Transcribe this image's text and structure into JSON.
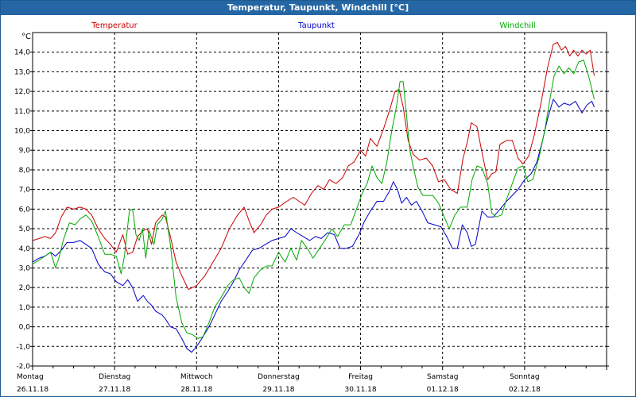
{
  "window": {
    "title": "Temperatur, Taupunkt, Windchill [°C]"
  },
  "chart_data": {
    "type": "line",
    "title": "Temperatur, Taupunkt, Windchill [°C]",
    "unit": "°C",
    "ylim": [
      -2.0,
      15.0
    ],
    "y_ticks": [
      "-2,0",
      "-1,0",
      "0,0",
      "1,0",
      "2,0",
      "3,0",
      "4,0",
      "5,0",
      "6,0",
      "7,0",
      "8,0",
      "9,0",
      "10,0",
      "11,0",
      "12,0",
      "13,0",
      "14,0"
    ],
    "x_range_days": 7,
    "x_day_labels": [
      {
        "day": "Montag",
        "date": "26.11.18"
      },
      {
        "day": "Dienstag",
        "date": "27.11.18"
      },
      {
        "day": "Mittwoch",
        "date": "28.11.18"
      },
      {
        "day": "Donnerstag",
        "date": "29.11.18"
      },
      {
        "day": "Freitag",
        "date": "30.11.18"
      },
      {
        "day": "Samstag",
        "date": "01.12.18"
      },
      {
        "day": "Sonntag",
        "date": "02.12.18"
      }
    ],
    "grid": true,
    "legend_position": "top",
    "series": [
      {
        "name": "Temperatur",
        "color": "#cc0000",
        "points": [
          [
            0.0,
            4.4
          ],
          [
            0.08,
            4.5
          ],
          [
            0.15,
            4.6
          ],
          [
            0.22,
            4.5
          ],
          [
            0.28,
            4.8
          ],
          [
            0.35,
            5.6
          ],
          [
            0.42,
            6.1
          ],
          [
            0.5,
            6.0
          ],
          [
            0.58,
            6.1
          ],
          [
            0.65,
            6.0
          ],
          [
            0.72,
            5.7
          ],
          [
            0.8,
            5.0
          ],
          [
            0.88,
            4.5
          ],
          [
            0.95,
            4.2
          ],
          [
            1.02,
            3.8
          ],
          [
            1.1,
            4.7
          ],
          [
            1.16,
            3.7
          ],
          [
            1.22,
            3.8
          ],
          [
            1.28,
            4.6
          ],
          [
            1.35,
            4.9
          ],
          [
            1.4,
            5.0
          ],
          [
            1.45,
            4.2
          ],
          [
            1.5,
            5.3
          ],
          [
            1.58,
            5.7
          ],
          [
            1.62,
            5.6
          ],
          [
            1.68,
            4.6
          ],
          [
            1.75,
            3.3
          ],
          [
            1.82,
            2.6
          ],
          [
            1.9,
            1.9
          ],
          [
            2.0,
            2.1
          ],
          [
            2.1,
            2.6
          ],
          [
            2.2,
            3.3
          ],
          [
            2.3,
            4.0
          ],
          [
            2.4,
            5.0
          ],
          [
            2.5,
            5.7
          ],
          [
            2.58,
            6.1
          ],
          [
            2.64,
            5.4
          ],
          [
            2.7,
            4.8
          ],
          [
            2.78,
            5.2
          ],
          [
            2.85,
            5.7
          ],
          [
            2.92,
            6.0
          ],
          [
            3.0,
            6.1
          ],
          [
            3.1,
            6.4
          ],
          [
            3.18,
            6.6
          ],
          [
            3.25,
            6.4
          ],
          [
            3.32,
            6.2
          ],
          [
            3.4,
            6.8
          ],
          [
            3.48,
            7.2
          ],
          [
            3.55,
            7.0
          ],
          [
            3.62,
            7.5
          ],
          [
            3.7,
            7.3
          ],
          [
            3.78,
            7.6
          ],
          [
            3.85,
            8.2
          ],
          [
            3.92,
            8.4
          ],
          [
            4.0,
            9.0
          ],
          [
            4.06,
            8.7
          ],
          [
            4.12,
            9.6
          ],
          [
            4.2,
            9.2
          ],
          [
            4.28,
            10.1
          ],
          [
            4.35,
            11.0
          ],
          [
            4.42,
            12.0
          ],
          [
            4.47,
            12.1
          ],
          [
            4.52,
            11.2
          ],
          [
            4.58,
            9.5
          ],
          [
            4.64,
            8.8
          ],
          [
            4.72,
            8.5
          ],
          [
            4.8,
            8.6
          ],
          [
            4.88,
            8.2
          ],
          [
            4.95,
            7.4
          ],
          [
            5.02,
            7.5
          ],
          [
            5.1,
            7.0
          ],
          [
            5.18,
            6.8
          ],
          [
            5.25,
            8.6
          ],
          [
            5.3,
            9.4
          ],
          [
            5.35,
            10.4
          ],
          [
            5.42,
            10.2
          ],
          [
            5.48,
            8.9
          ],
          [
            5.55,
            7.5
          ],
          [
            5.6,
            7.8
          ],
          [
            5.65,
            7.9
          ],
          [
            5.7,
            9.3
          ],
          [
            5.78,
            9.5
          ],
          [
            5.85,
            9.5
          ],
          [
            5.92,
            8.6
          ],
          [
            5.98,
            8.3
          ],
          [
            6.05,
            8.7
          ],
          [
            6.12,
            9.8
          ],
          [
            6.2,
            11.4
          ],
          [
            6.28,
            13.2
          ],
          [
            6.35,
            14.4
          ],
          [
            6.4,
            14.5
          ],
          [
            6.45,
            14.1
          ],
          [
            6.5,
            14.3
          ],
          [
            6.55,
            13.8
          ],
          [
            6.6,
            14.1
          ],
          [
            6.65,
            13.8
          ],
          [
            6.7,
            14.1
          ],
          [
            6.75,
            13.9
          ],
          [
            6.8,
            14.1
          ],
          [
            6.85,
            12.8
          ]
        ]
      },
      {
        "name": "Taupunkt",
        "color": "#0000cc",
        "points": [
          [
            0.0,
            3.3
          ],
          [
            0.08,
            3.5
          ],
          [
            0.15,
            3.6
          ],
          [
            0.22,
            3.8
          ],
          [
            0.28,
            3.6
          ],
          [
            0.35,
            3.9
          ],
          [
            0.42,
            4.3
          ],
          [
            0.5,
            4.3
          ],
          [
            0.58,
            4.4
          ],
          [
            0.65,
            4.2
          ],
          [
            0.72,
            4.0
          ],
          [
            0.8,
            3.2
          ],
          [
            0.88,
            2.8
          ],
          [
            0.95,
            2.7
          ],
          [
            1.02,
            2.3
          ],
          [
            1.1,
            2.1
          ],
          [
            1.16,
            2.4
          ],
          [
            1.22,
            2.0
          ],
          [
            1.28,
            1.3
          ],
          [
            1.35,
            1.6
          ],
          [
            1.4,
            1.3
          ],
          [
            1.45,
            1.1
          ],
          [
            1.5,
            0.8
          ],
          [
            1.58,
            0.6
          ],
          [
            1.62,
            0.4
          ],
          [
            1.68,
            0.0
          ],
          [
            1.75,
            -0.1
          ],
          [
            1.82,
            -0.6
          ],
          [
            1.88,
            -1.1
          ],
          [
            1.94,
            -1.3
          ],
          [
            2.0,
            -1.0
          ],
          [
            2.08,
            -0.5
          ],
          [
            2.15,
            0.0
          ],
          [
            2.22,
            0.6
          ],
          [
            2.3,
            1.3
          ],
          [
            2.38,
            1.8
          ],
          [
            2.45,
            2.3
          ],
          [
            2.52,
            2.9
          ],
          [
            2.6,
            3.4
          ],
          [
            2.68,
            3.9
          ],
          [
            2.76,
            4.0
          ],
          [
            2.84,
            4.2
          ],
          [
            2.92,
            4.4
          ],
          [
            3.0,
            4.5
          ],
          [
            3.08,
            4.6
          ],
          [
            3.15,
            5.0
          ],
          [
            3.22,
            4.8
          ],
          [
            3.3,
            4.6
          ],
          [
            3.38,
            4.4
          ],
          [
            3.45,
            4.6
          ],
          [
            3.52,
            4.5
          ],
          [
            3.6,
            4.8
          ],
          [
            3.68,
            4.7
          ],
          [
            3.75,
            4.0
          ],
          [
            3.82,
            4.0
          ],
          [
            3.9,
            4.1
          ],
          [
            3.98,
            4.7
          ],
          [
            4.05,
            5.4
          ],
          [
            4.12,
            5.9
          ],
          [
            4.2,
            6.4
          ],
          [
            4.28,
            6.4
          ],
          [
            4.35,
            6.9
          ],
          [
            4.4,
            7.4
          ],
          [
            4.45,
            7.0
          ],
          [
            4.5,
            6.3
          ],
          [
            4.56,
            6.6
          ],
          [
            4.62,
            6.2
          ],
          [
            4.68,
            6.4
          ],
          [
            4.75,
            5.9
          ],
          [
            4.82,
            5.3
          ],
          [
            4.9,
            5.2
          ],
          [
            4.98,
            5.1
          ],
          [
            5.05,
            4.6
          ],
          [
            5.12,
            4.0
          ],
          [
            5.18,
            4.0
          ],
          [
            5.24,
            5.2
          ],
          [
            5.3,
            4.8
          ],
          [
            5.35,
            4.1
          ],
          [
            5.4,
            4.2
          ],
          [
            5.48,
            5.9
          ],
          [
            5.55,
            5.6
          ],
          [
            5.62,
            5.6
          ],
          [
            5.7,
            6.0
          ],
          [
            5.78,
            6.4
          ],
          [
            5.85,
            6.7
          ],
          [
            5.92,
            7.0
          ],
          [
            6.0,
            7.5
          ],
          [
            6.08,
            7.8
          ],
          [
            6.15,
            8.4
          ],
          [
            6.22,
            9.5
          ],
          [
            6.28,
            10.6
          ],
          [
            6.35,
            11.6
          ],
          [
            6.42,
            11.2
          ],
          [
            6.48,
            11.4
          ],
          [
            6.55,
            11.3
          ],
          [
            6.62,
            11.5
          ],
          [
            6.7,
            10.9
          ],
          [
            6.76,
            11.3
          ],
          [
            6.82,
            11.5
          ],
          [
            6.85,
            11.2
          ]
        ]
      },
      {
        "name": "Windchill",
        "color": "#00aa00",
        "points": [
          [
            0.0,
            3.2
          ],
          [
            0.08,
            3.4
          ],
          [
            0.15,
            3.6
          ],
          [
            0.22,
            3.8
          ],
          [
            0.28,
            3.0
          ],
          [
            0.32,
            3.5
          ],
          [
            0.38,
            4.5
          ],
          [
            0.45,
            5.3
          ],
          [
            0.52,
            5.2
          ],
          [
            0.58,
            5.5
          ],
          [
            0.65,
            5.7
          ],
          [
            0.72,
            5.4
          ],
          [
            0.8,
            4.6
          ],
          [
            0.88,
            3.7
          ],
          [
            0.95,
            3.7
          ],
          [
            1.02,
            3.6
          ],
          [
            1.08,
            2.7
          ],
          [
            1.12,
            3.6
          ],
          [
            1.18,
            5.9
          ],
          [
            1.22,
            6.0
          ],
          [
            1.26,
            4.7
          ],
          [
            1.3,
            4.4
          ],
          [
            1.34,
            5.0
          ],
          [
            1.38,
            3.5
          ],
          [
            1.42,
            4.9
          ],
          [
            1.48,
            4.2
          ],
          [
            1.52,
            5.2
          ],
          [
            1.58,
            5.5
          ],
          [
            1.62,
            5.9
          ],
          [
            1.68,
            4.2
          ],
          [
            1.75,
            1.5
          ],
          [
            1.82,
            0.2
          ],
          [
            1.88,
            -0.3
          ],
          [
            1.95,
            -0.4
          ],
          [
            2.02,
            -0.6
          ],
          [
            2.08,
            -0.5
          ],
          [
            2.15,
            0.2
          ],
          [
            2.22,
            1.0
          ],
          [
            2.3,
            1.5
          ],
          [
            2.38,
            2.1
          ],
          [
            2.45,
            2.4
          ],
          [
            2.52,
            2.5
          ],
          [
            2.58,
            2.0
          ],
          [
            2.64,
            1.7
          ],
          [
            2.7,
            2.5
          ],
          [
            2.78,
            2.9
          ],
          [
            2.85,
            3.1
          ],
          [
            2.92,
            3.1
          ],
          [
            3.0,
            3.8
          ],
          [
            3.08,
            3.3
          ],
          [
            3.15,
            4.0
          ],
          [
            3.22,
            3.4
          ],
          [
            3.28,
            4.4
          ],
          [
            3.35,
            4.0
          ],
          [
            3.42,
            3.5
          ],
          [
            3.5,
            4.0
          ],
          [
            3.58,
            4.5
          ],
          [
            3.65,
            5.0
          ],
          [
            3.72,
            4.6
          ],
          [
            3.8,
            5.2
          ],
          [
            3.88,
            5.2
          ],
          [
            3.95,
            6.0
          ],
          [
            4.02,
            6.8
          ],
          [
            4.08,
            7.3
          ],
          [
            4.14,
            8.2
          ],
          [
            4.2,
            7.6
          ],
          [
            4.26,
            7.3
          ],
          [
            4.32,
            8.4
          ],
          [
            4.38,
            10.0
          ],
          [
            4.44,
            11.3
          ],
          [
            4.48,
            12.5
          ],
          [
            4.52,
            12.5
          ],
          [
            4.56,
            10.8
          ],
          [
            4.6,
            9.0
          ],
          [
            4.65,
            8.0
          ],
          [
            4.7,
            7.1
          ],
          [
            4.76,
            6.7
          ],
          [
            4.82,
            6.7
          ],
          [
            4.88,
            6.7
          ],
          [
            4.95,
            6.3
          ],
          [
            5.02,
            5.6
          ],
          [
            5.08,
            5.0
          ],
          [
            5.15,
            5.7
          ],
          [
            5.22,
            6.1
          ],
          [
            5.3,
            6.1
          ],
          [
            5.36,
            7.5
          ],
          [
            5.42,
            8.2
          ],
          [
            5.48,
            8.1
          ],
          [
            5.55,
            7.3
          ],
          [
            5.6,
            5.8
          ],
          [
            5.65,
            5.6
          ],
          [
            5.72,
            5.7
          ],
          [
            5.78,
            6.5
          ],
          [
            5.85,
            7.3
          ],
          [
            5.92,
            8.1
          ],
          [
            5.98,
            8.2
          ],
          [
            6.04,
            7.4
          ],
          [
            6.1,
            7.5
          ],
          [
            6.18,
            8.7
          ],
          [
            6.25,
            10.1
          ],
          [
            6.3,
            11.4
          ],
          [
            6.36,
            12.8
          ],
          [
            6.42,
            13.3
          ],
          [
            6.48,
            12.9
          ],
          [
            6.54,
            13.2
          ],
          [
            6.6,
            12.9
          ],
          [
            6.66,
            13.5
          ],
          [
            6.72,
            13.6
          ],
          [
            6.78,
            12.8
          ],
          [
            6.85,
            11.6
          ]
        ]
      }
    ]
  }
}
